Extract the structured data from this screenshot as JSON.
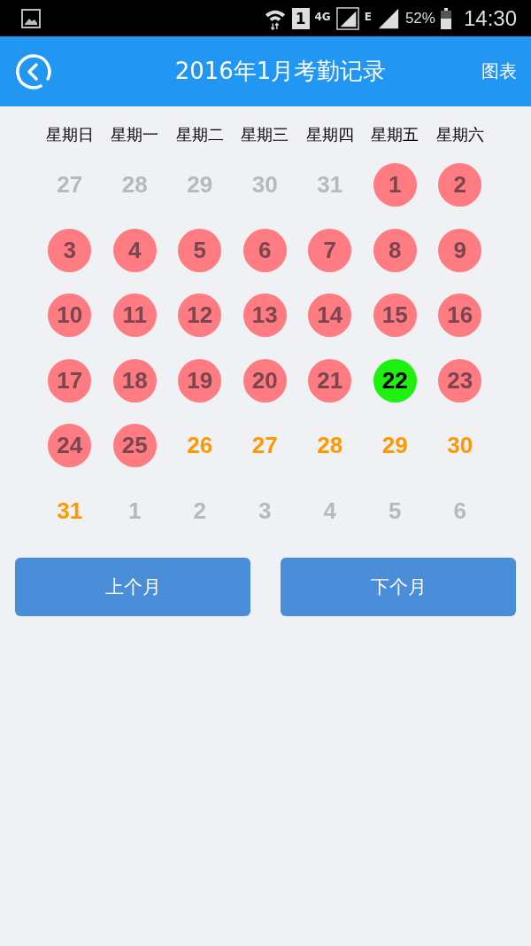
{
  "status_bar": {
    "network": "4G",
    "network_2": "E",
    "battery": "52%",
    "time": "14:30",
    "sim": "1"
  },
  "header": {
    "title": "2016年1月考勤记录",
    "action": "图表"
  },
  "weekdays": [
    "星期日",
    "星期一",
    "星期二",
    "星期三",
    "星期四",
    "星期五",
    "星期六"
  ],
  "days": [
    {
      "label": "27",
      "kind": "other"
    },
    {
      "label": "28",
      "kind": "other"
    },
    {
      "label": "29",
      "kind": "other"
    },
    {
      "label": "30",
      "kind": "other"
    },
    {
      "label": "31",
      "kind": "other"
    },
    {
      "label": "1",
      "kind": "absent"
    },
    {
      "label": "2",
      "kind": "absent"
    },
    {
      "label": "3",
      "kind": "absent"
    },
    {
      "label": "4",
      "kind": "absent"
    },
    {
      "label": "5",
      "kind": "absent"
    },
    {
      "label": "6",
      "kind": "absent"
    },
    {
      "label": "7",
      "kind": "absent"
    },
    {
      "label": "8",
      "kind": "absent"
    },
    {
      "label": "9",
      "kind": "absent"
    },
    {
      "label": "10",
      "kind": "absent"
    },
    {
      "label": "11",
      "kind": "absent"
    },
    {
      "label": "12",
      "kind": "absent"
    },
    {
      "label": "13",
      "kind": "absent"
    },
    {
      "label": "14",
      "kind": "absent"
    },
    {
      "label": "15",
      "kind": "absent"
    },
    {
      "label": "16",
      "kind": "absent"
    },
    {
      "label": "17",
      "kind": "absent"
    },
    {
      "label": "18",
      "kind": "absent"
    },
    {
      "label": "19",
      "kind": "absent"
    },
    {
      "label": "20",
      "kind": "absent"
    },
    {
      "label": "21",
      "kind": "absent"
    },
    {
      "label": "22",
      "kind": "today"
    },
    {
      "label": "23",
      "kind": "absent"
    },
    {
      "label": "24",
      "kind": "absent"
    },
    {
      "label": "25",
      "kind": "absent"
    },
    {
      "label": "26",
      "kind": "future"
    },
    {
      "label": "27",
      "kind": "future"
    },
    {
      "label": "28",
      "kind": "future"
    },
    {
      "label": "29",
      "kind": "future"
    },
    {
      "label": "30",
      "kind": "future"
    },
    {
      "label": "31",
      "kind": "future"
    },
    {
      "label": "1",
      "kind": "other"
    },
    {
      "label": "2",
      "kind": "other"
    },
    {
      "label": "3",
      "kind": "other"
    },
    {
      "label": "4",
      "kind": "other"
    },
    {
      "label": "5",
      "kind": "other"
    },
    {
      "label": "6",
      "kind": "other"
    }
  ],
  "buttons": [
    "上个月",
    "下个月"
  ]
}
